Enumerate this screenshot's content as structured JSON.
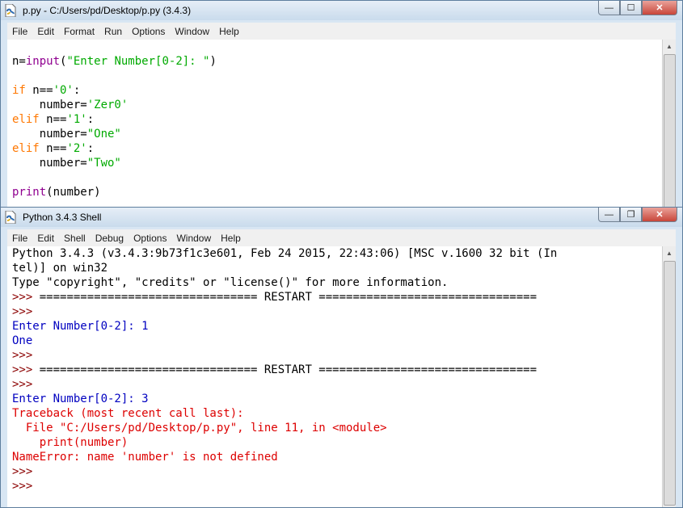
{
  "editor": {
    "title": "p.py - C:/Users/pd/Desktop/p.py (3.4.3)",
    "menu": [
      "File",
      "Edit",
      "Format",
      "Run",
      "Options",
      "Window",
      "Help"
    ],
    "code": [
      "",
      "n=input(\"Enter Number[0-2]: \")",
      "",
      "if n=='0':",
      "    number='Zer0'",
      "elif n=='1':",
      "    number=\"One\"",
      "elif n=='2':",
      "    number=\"Two\"",
      "",
      "print(number)"
    ]
  },
  "shell": {
    "title": "Python 3.4.3 Shell",
    "menu": [
      "File",
      "Edit",
      "Shell",
      "Debug",
      "Options",
      "Window",
      "Help"
    ],
    "lines": [
      "Python 3.4.3 (v3.4.3:9b73f1c3e601, Feb 24 2015, 22:43:06) [MSC v.1600 32 bit (In",
      "tel)] on win32",
      "Type \"copyright\", \"credits\" or \"license()\" for more information.",
      ">>> ================================ RESTART ================================",
      ">>>",
      "Enter Number[0-2]: 1",
      "One",
      ">>>",
      ">>> ================================ RESTART ================================",
      ">>>",
      "Enter Number[0-2]: 3",
      "Traceback (most recent call last):",
      "  File \"C:/Users/pd/Desktop/p.py\", line 11, in <module>",
      "    print(number)",
      "NameError: name 'number' is not defined",
      ">>>",
      ">>>"
    ]
  },
  "window_controls": {
    "minimize": "—",
    "maximize": "☐",
    "restore": "❐",
    "close": "✕"
  },
  "colors": {
    "keyword": "#ff7700",
    "builtin": "#900090",
    "string": "#00aa00",
    "stdout": "#0000c0",
    "stderr": "#dd0000",
    "prompt": "#8b0000"
  }
}
